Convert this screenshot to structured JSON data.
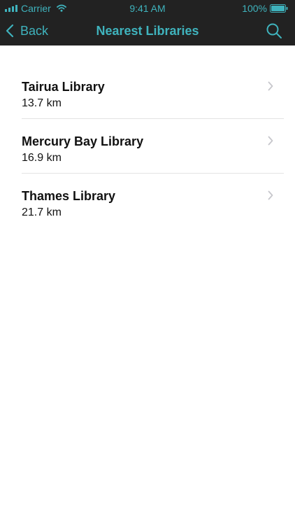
{
  "status_bar": {
    "carrier": "Carrier",
    "time": "9:41 AM",
    "battery": "100%"
  },
  "nav": {
    "back_label": "Back",
    "title": "Nearest Libraries"
  },
  "libraries": [
    {
      "name": "Tairua Library",
      "distance": "13.7 km"
    },
    {
      "name": "Mercury Bay Library",
      "distance": "16.9 km"
    },
    {
      "name": "Thames Library",
      "distance": "21.7 km"
    }
  ],
  "colors": {
    "accent": "#3fb3bd",
    "bar_background": "#222222",
    "text": "#111111",
    "divider": "#e3e3e3",
    "chevron": "#c7c7cc"
  },
  "icons": {
    "signal": "signal-bars-icon",
    "wifi": "wifi-icon",
    "battery": "battery-icon",
    "back": "chevron-left-icon",
    "search": "search-icon",
    "row": "chevron-right-icon"
  }
}
